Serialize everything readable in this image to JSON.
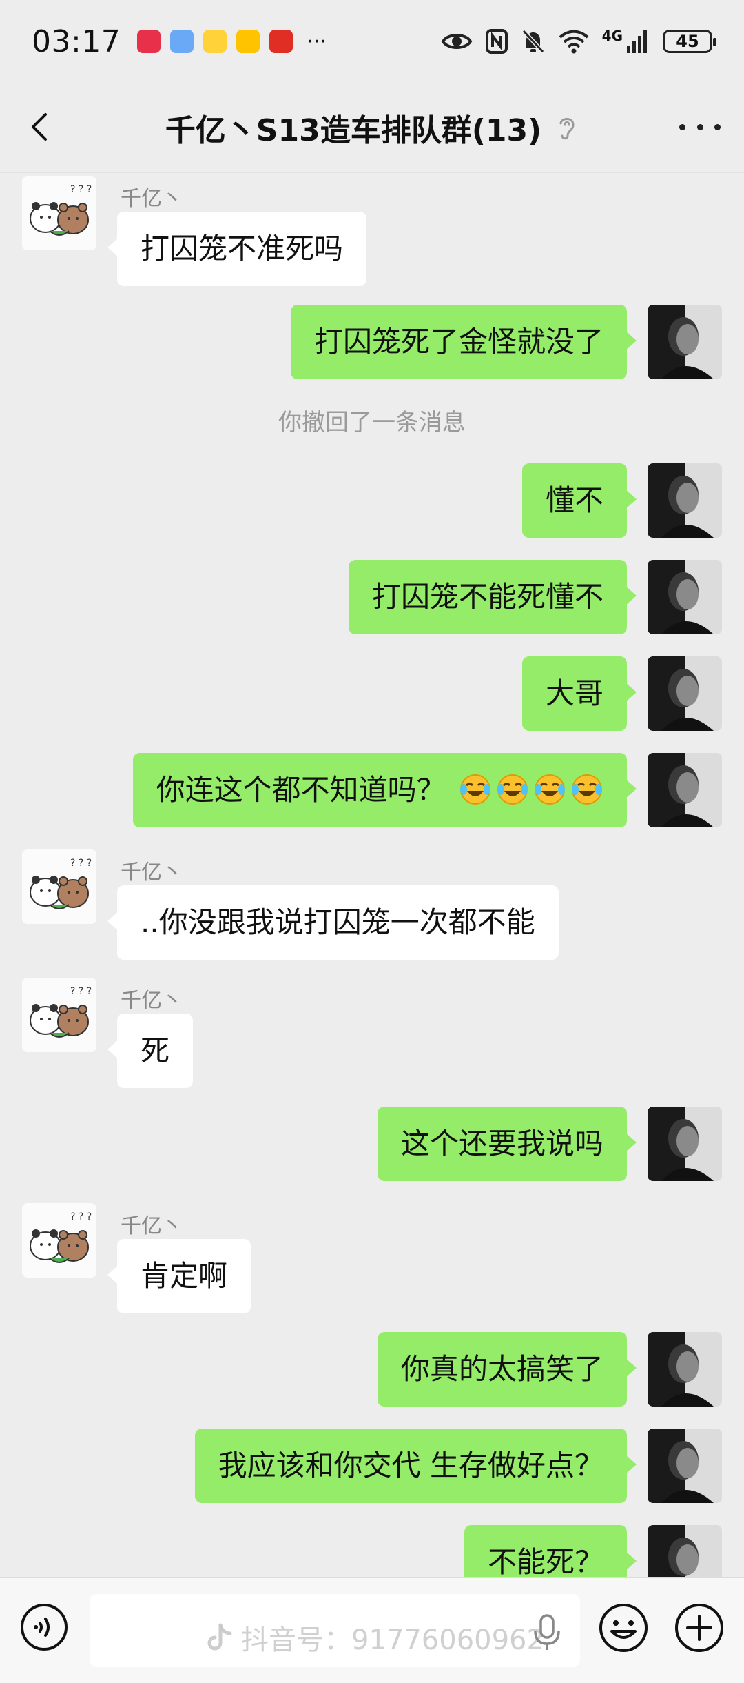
{
  "status_bar": {
    "time": "03:17",
    "network_label": "4G",
    "battery": "45",
    "more": "···"
  },
  "header": {
    "title": "千亿丶S13造车排队群(13)"
  },
  "messages": [
    {
      "id": 0,
      "side": "left",
      "sender": "千亿丶",
      "text": "打囚笼不准死吗"
    },
    {
      "id": 1,
      "side": "right",
      "text": "打囚笼死了金怪就没了"
    },
    {
      "id": 2,
      "type": "system",
      "text": "你撤回了一条消息"
    },
    {
      "id": 3,
      "side": "right",
      "text": "懂不"
    },
    {
      "id": 4,
      "side": "right",
      "text": "打囚笼不能死懂不"
    },
    {
      "id": 5,
      "side": "right",
      "text": "大哥"
    },
    {
      "id": 6,
      "side": "right",
      "text": "你连这个都不知道吗？",
      "emoji": [
        "face-with-tears-of-joy",
        "face-with-tears-of-joy",
        "face-with-tears-of-joy",
        "face-with-tears-of-joy"
      ]
    },
    {
      "id": 7,
      "side": "left",
      "sender": "千亿丶",
      "text": "..你没跟我说打囚笼一次都不能"
    },
    {
      "id": 8,
      "side": "left",
      "sender": "千亿丶",
      "text": "死"
    },
    {
      "id": 9,
      "side": "right",
      "text": "这个还要我说吗"
    },
    {
      "id": 10,
      "side": "left",
      "sender": "千亿丶",
      "text": "肯定啊"
    },
    {
      "id": 11,
      "side": "right",
      "text": "你真的太搞笑了"
    },
    {
      "id": 12,
      "side": "right",
      "text": "我应该和你交代 生存做好点？"
    },
    {
      "id": 13,
      "side": "right",
      "text": "不能死？"
    }
  ],
  "input_bar": {
    "placeholder": "",
    "watermark": "抖音号：91776060962"
  },
  "colors": {
    "background": "#ededed",
    "bubble_self": "#95ec69",
    "bubble_other": "#ffffff",
    "system_text": "#9a9a9a"
  }
}
